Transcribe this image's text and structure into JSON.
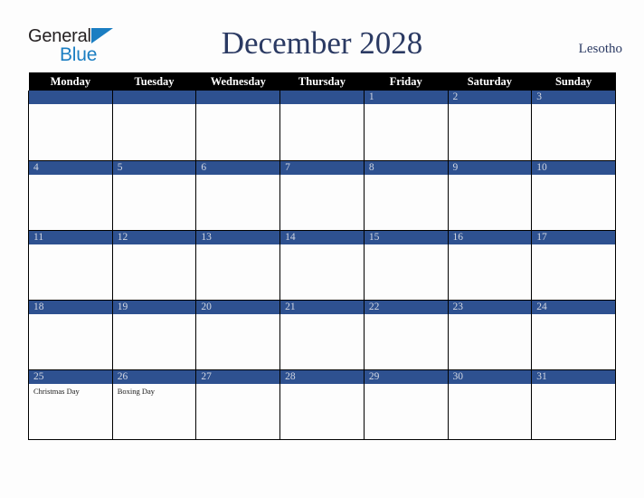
{
  "brand": {
    "word_one": "General",
    "word_two": "Blue",
    "triangle_color": "#1b7ec2",
    "text_color": "#231f20"
  },
  "header": {
    "title": "December 2028",
    "country": "Lesotho",
    "title_color": "#2b3a63"
  },
  "calendar": {
    "accent_color": "#2e5190",
    "header_bg": "#000000",
    "header_fg": "#ffffff",
    "weekday_headers": [
      "Monday",
      "Tuesday",
      "Wednesday",
      "Thursday",
      "Friday",
      "Saturday",
      "Sunday"
    ],
    "weeks": [
      [
        {
          "day": "",
          "events": []
        },
        {
          "day": "",
          "events": []
        },
        {
          "day": "",
          "events": []
        },
        {
          "day": "",
          "events": []
        },
        {
          "day": "1",
          "events": []
        },
        {
          "day": "2",
          "events": []
        },
        {
          "day": "3",
          "events": []
        }
      ],
      [
        {
          "day": "4",
          "events": []
        },
        {
          "day": "5",
          "events": []
        },
        {
          "day": "6",
          "events": []
        },
        {
          "day": "7",
          "events": []
        },
        {
          "day": "8",
          "events": []
        },
        {
          "day": "9",
          "events": []
        },
        {
          "day": "10",
          "events": []
        }
      ],
      [
        {
          "day": "11",
          "events": []
        },
        {
          "day": "12",
          "events": []
        },
        {
          "day": "13",
          "events": []
        },
        {
          "day": "14",
          "events": []
        },
        {
          "day": "15",
          "events": []
        },
        {
          "day": "16",
          "events": []
        },
        {
          "day": "17",
          "events": []
        }
      ],
      [
        {
          "day": "18",
          "events": []
        },
        {
          "day": "19",
          "events": []
        },
        {
          "day": "20",
          "events": []
        },
        {
          "day": "21",
          "events": []
        },
        {
          "day": "22",
          "events": []
        },
        {
          "day": "23",
          "events": []
        },
        {
          "day": "24",
          "events": []
        }
      ],
      [
        {
          "day": "25",
          "events": [
            "Christmas Day"
          ]
        },
        {
          "day": "26",
          "events": [
            "Boxing Day"
          ]
        },
        {
          "day": "27",
          "events": []
        },
        {
          "day": "28",
          "events": []
        },
        {
          "day": "29",
          "events": []
        },
        {
          "day": "30",
          "events": []
        },
        {
          "day": "31",
          "events": []
        }
      ]
    ]
  }
}
